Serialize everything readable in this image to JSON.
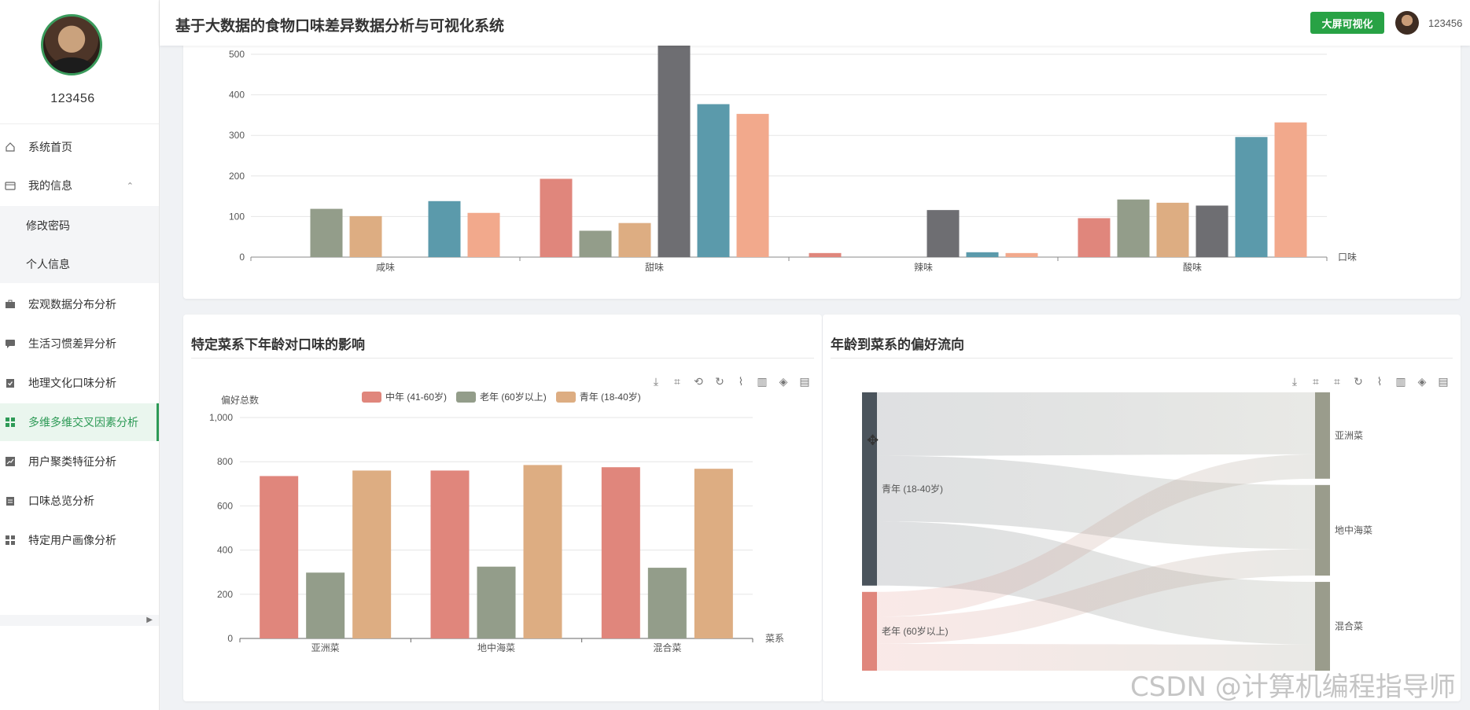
{
  "sidebar": {
    "username": "123456",
    "items": [
      {
        "label": "系统首页",
        "icon": "home-icon"
      },
      {
        "label": "我的信息",
        "icon": "card-icon",
        "chevron": "⌃"
      },
      {
        "label": "修改密码"
      },
      {
        "label": "个人信息"
      },
      {
        "label": "宏观数据分布分析",
        "icon": "briefcase-icon"
      },
      {
        "label": "生活习惯差异分析",
        "icon": "chat-icon"
      },
      {
        "label": "地理文化口味分析",
        "icon": "clipboard-check-icon"
      },
      {
        "label": "多维多维交叉因素分析",
        "icon": "grid-icon"
      },
      {
        "label": "用户聚类特征分析",
        "icon": "trend-icon"
      },
      {
        "label": "口味总览分析",
        "icon": "clipboard-icon"
      },
      {
        "label": "特定用户画像分析",
        "icon": "grid-icon"
      }
    ]
  },
  "header": {
    "title": "基于大数据的食物口味差异数据分析与可视化系统",
    "big_screen_button": "大屏可视化",
    "user": "123456"
  },
  "cards": {
    "bottom_left_title": "特定菜系下年龄对口味的影响",
    "bottom_right_title": "年龄到菜系的偏好流向"
  },
  "colors": {
    "red": "#e0867c",
    "sage": "#939d8a",
    "tan": "#ddad82",
    "gray": "#6e6e72",
    "teal": "#5b9aab",
    "salmon": "#f2a98c",
    "accent_green": "#28a245"
  },
  "chart_data": [
    {
      "type": "bar",
      "categories": [
        "咸味",
        "甜味",
        "辣味",
        "酸味"
      ],
      "xlabel": "口味",
      "ylim": [
        0,
        500
      ],
      "yticks": [
        0,
        100,
        200,
        300,
        400,
        500
      ],
      "series": [
        {
          "values": [
            0,
            193,
            10,
            96
          ],
          "color": "#e0867c"
        },
        {
          "values": [
            119,
            65,
            0,
            142
          ],
          "color": "#939d8a"
        },
        {
          "values": [
            101,
            84,
            0,
            134
          ],
          "color": "#ddad82"
        },
        {
          "values": [
            0,
            525,
            116,
            127
          ],
          "color": "#6e6e72"
        },
        {
          "values": [
            138,
            377,
            12,
            296
          ],
          "color": "#5b9aab"
        },
        {
          "values": [
            109,
            353,
            10,
            332
          ],
          "color": "#f2a98c"
        }
      ]
    },
    {
      "type": "bar",
      "categories": [
        "亚洲菜",
        "地中海菜",
        "混合菜"
      ],
      "ylabel": "偏好总数",
      "xlabel": "菜系",
      "ylim": [
        0,
        1000
      ],
      "yticks": [
        "0",
        "200",
        "400",
        "600",
        "800",
        "1,000"
      ],
      "series": [
        {
          "name": "中年 (41-60岁)",
          "values": [
            735,
            760,
            775
          ],
          "color": "#e0867c"
        },
        {
          "name": "老年 (60岁以上)",
          "values": [
            298,
            325,
            320
          ],
          "color": "#939d8a"
        },
        {
          "name": "青年 (18-40岁)",
          "values": [
            760,
            785,
            768
          ],
          "color": "#ddad82"
        }
      ]
    },
    {
      "type": "sankey",
      "sources": [
        {
          "name": "青年 (18-40岁)",
          "color": "#4b545c"
        },
        {
          "name": "老年 (60岁以上)",
          "color": "#e0867c"
        }
      ],
      "targets": [
        {
          "name": "亚洲菜",
          "color": "#9a9c8c"
        },
        {
          "name": "地中海菜",
          "color": "#9a9c8c"
        },
        {
          "name": "混合菜",
          "color": "#9a9c8c"
        }
      ],
      "links": [
        {
          "source": "青年 (18-40岁)",
          "target": "亚洲菜",
          "value": 760
        },
        {
          "source": "青年 (18-40岁)",
          "target": "地中海菜",
          "value": 785
        },
        {
          "source": "青年 (18-40岁)",
          "target": "混合菜",
          "value": 768
        },
        {
          "source": "老年 (60岁以上)",
          "target": "亚洲菜",
          "value": 298
        },
        {
          "source": "老年 (60岁以上)",
          "target": "地中海菜",
          "value": 325
        },
        {
          "source": "老年 (60岁以上)",
          "target": "混合菜",
          "value": 320
        }
      ]
    }
  ],
  "toolbox_icons": [
    "download-icon",
    "crop-icon",
    "crop-back-icon",
    "refresh-icon",
    "line-chart-icon",
    "bar-chart-icon",
    "stack-icon",
    "data-view-icon"
  ],
  "watermark": "CSDN @计算机编程指导师"
}
